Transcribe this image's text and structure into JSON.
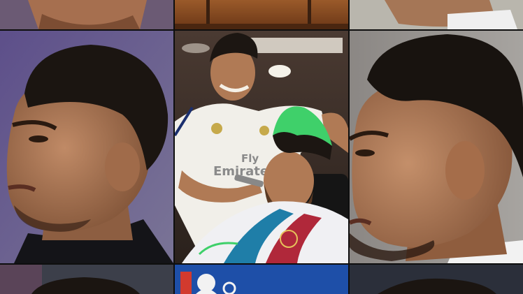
{
  "jersey": {
    "sponsor_line1": "Fly",
    "sponsor_line2": "Emirates"
  },
  "colors": {
    "divider": "#0e0e0e",
    "barcelona_blue": "#1f7ea8",
    "barcelona_red": "#b0283a",
    "green_hair": "#3fd06a",
    "skin": "#b07a55",
    "hair": "#1c1612",
    "bot_mid_blue": "#1e4fa8"
  }
}
